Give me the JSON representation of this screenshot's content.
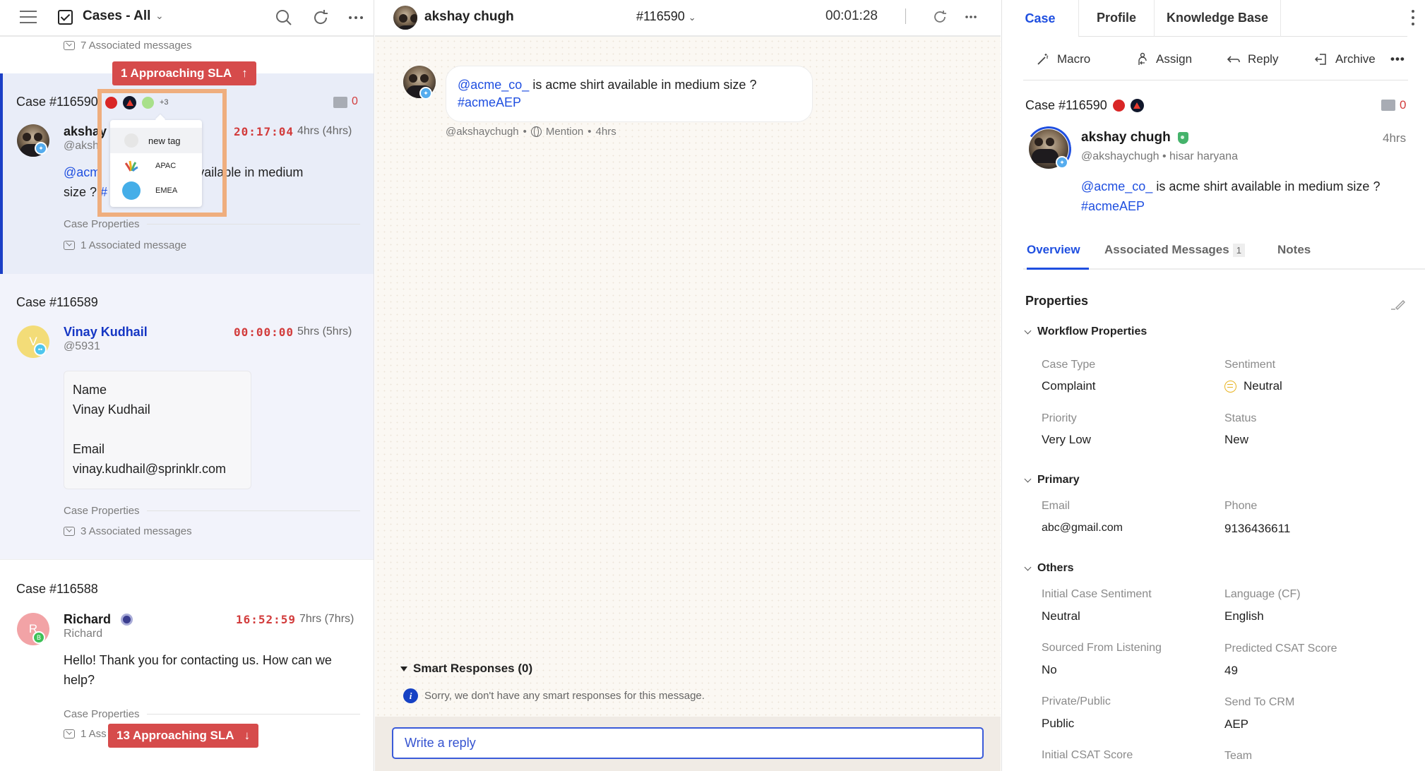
{
  "left_panel": {
    "header": {
      "title": "Cases - All",
      "icons": [
        "menu-icon",
        "checkbox-icon",
        "chevron-down-icon",
        "search-icon",
        "refresh-icon",
        "more-icon"
      ]
    },
    "stub": {
      "associated": "7 Associated messages"
    },
    "sla_top": {
      "label": "1 Approaching SLA",
      "arrow": "↑"
    },
    "sla_bottom": {
      "label": "13 Approaching SLA",
      "arrow": "↓"
    },
    "cases": [
      {
        "id": "Case #116590",
        "stat_count": "0",
        "name": "akshay",
        "handle": "@aksh",
        "timer": "20:17:04",
        "ago": "4hrs (4hrs)",
        "message_mention": "@acm",
        "message_tail": "rt available in medium",
        "message_line2_a": "size ? ",
        "message_line2_hash": "#",
        "case_props": "Case Properties",
        "associated": "1 Associated message",
        "channel": "twitter"
      },
      {
        "id": "Case #116589",
        "name": "Vinay Kudhail",
        "handle": "@5931",
        "avatar_letter": "V",
        "timer": "00:00:00",
        "ago": "5hrs (5hrs)",
        "form": {
          "name_label": "Name",
          "name_value": "Vinay Kudhail",
          "email_label": "Email",
          "email_value": "vinay.kudhail@sprinklr.com"
        },
        "case_props": "Case Properties",
        "associated": "3 Associated messages",
        "channel": "chat"
      },
      {
        "id": "Case #116588",
        "name": "Richard",
        "handle": "Richard",
        "avatar_letter": "R",
        "timer": "16:52:59",
        "ago": "7hrs (7hrs)",
        "message": "Hello! Thank you for contacting us. How can we help?",
        "case_props": "Case Properties",
        "associated": "1 Ass",
        "channel": "whatsapp-business"
      }
    ],
    "tags": {
      "more": "+3",
      "dropdown": [
        {
          "label": "new tag",
          "color": "#e6e6e6"
        },
        {
          "label": "APAC",
          "color": "multicolor"
        },
        {
          "label": "EMEA",
          "color": "#45aee8"
        }
      ]
    }
  },
  "conversation": {
    "header": {
      "name": "akshay chugh",
      "case_number": "#116590",
      "timer": "00:01:28"
    },
    "message": {
      "mention": "@acme_co_",
      "text": " is acme shirt available in medium size ?",
      "hashtag": "#acmeAEP",
      "handle": "@akshaychugh",
      "type": "Mention",
      "ago": "4hrs"
    },
    "smart_responses": {
      "title": "Smart Responses (0)",
      "empty_text": "Sorry, we don't have any smart responses for this message."
    },
    "reply": {
      "placeholder": "Write a reply"
    }
  },
  "right_panel": {
    "tabs": [
      {
        "label": "Case",
        "active": true
      },
      {
        "label": "Profile",
        "active": false
      },
      {
        "label": "Knowledge Base",
        "active": false
      }
    ],
    "actions": [
      {
        "label": "Macro",
        "icon": "magic-wand-icon"
      },
      {
        "label": "Assign",
        "icon": "assign-user-icon"
      },
      {
        "label": "Reply",
        "icon": "reply-icon"
      },
      {
        "label": "Archive",
        "icon": "archive-icon"
      }
    ],
    "case_id": "Case #116590",
    "stat_count": "0",
    "profile": {
      "name": "akshay chugh",
      "handle": "@akshaychugh",
      "location": "hisar haryana",
      "ago": "4hrs",
      "mention": "@acme_co_",
      "text": " is acme shirt available in medium size ?",
      "hashtag": "#acmeAEP"
    },
    "subtabs": [
      {
        "label": "Overview",
        "active": true
      },
      {
        "label": "Associated Messages",
        "count": "1",
        "active": false
      },
      {
        "label": "Notes",
        "active": false
      }
    ],
    "properties_title": "Properties",
    "groups": {
      "workflow": {
        "title": "Workflow Properties",
        "fields": [
          {
            "label": "Case Type",
            "value": "Complaint"
          },
          {
            "label": "Sentiment",
            "value": "Neutral"
          },
          {
            "label": "Priority",
            "value": "Very Low"
          },
          {
            "label": "Status",
            "value": "New"
          }
        ]
      },
      "primary": {
        "title": "Primary",
        "fields": [
          {
            "label": "Email",
            "value": "abc@gmail.com"
          },
          {
            "label": "Phone",
            "value": "9136436611"
          }
        ]
      },
      "others": {
        "title": "Others",
        "fields": [
          {
            "label": "Initial Case Sentiment",
            "value": "Neutral"
          },
          {
            "label": "Language (CF)",
            "value": "English"
          },
          {
            "label": "Sourced From Listening",
            "value": "No"
          },
          {
            "label": "Predicted CSAT Score",
            "value": "49"
          },
          {
            "label": "Private/Public",
            "value": "Public"
          },
          {
            "label": "Send To CRM",
            "value": "AEP"
          },
          {
            "label": "Initial CSAT Score",
            "value": ""
          },
          {
            "label": "Team",
            "value": ""
          }
        ]
      }
    }
  },
  "colors": {
    "accent": "#1f4fe0",
    "sla_red": "#d64b4b",
    "timer_red": "#d23c3c",
    "selected_case_bg": "#e9edf8",
    "highlight_orange": "#efae7e"
  }
}
